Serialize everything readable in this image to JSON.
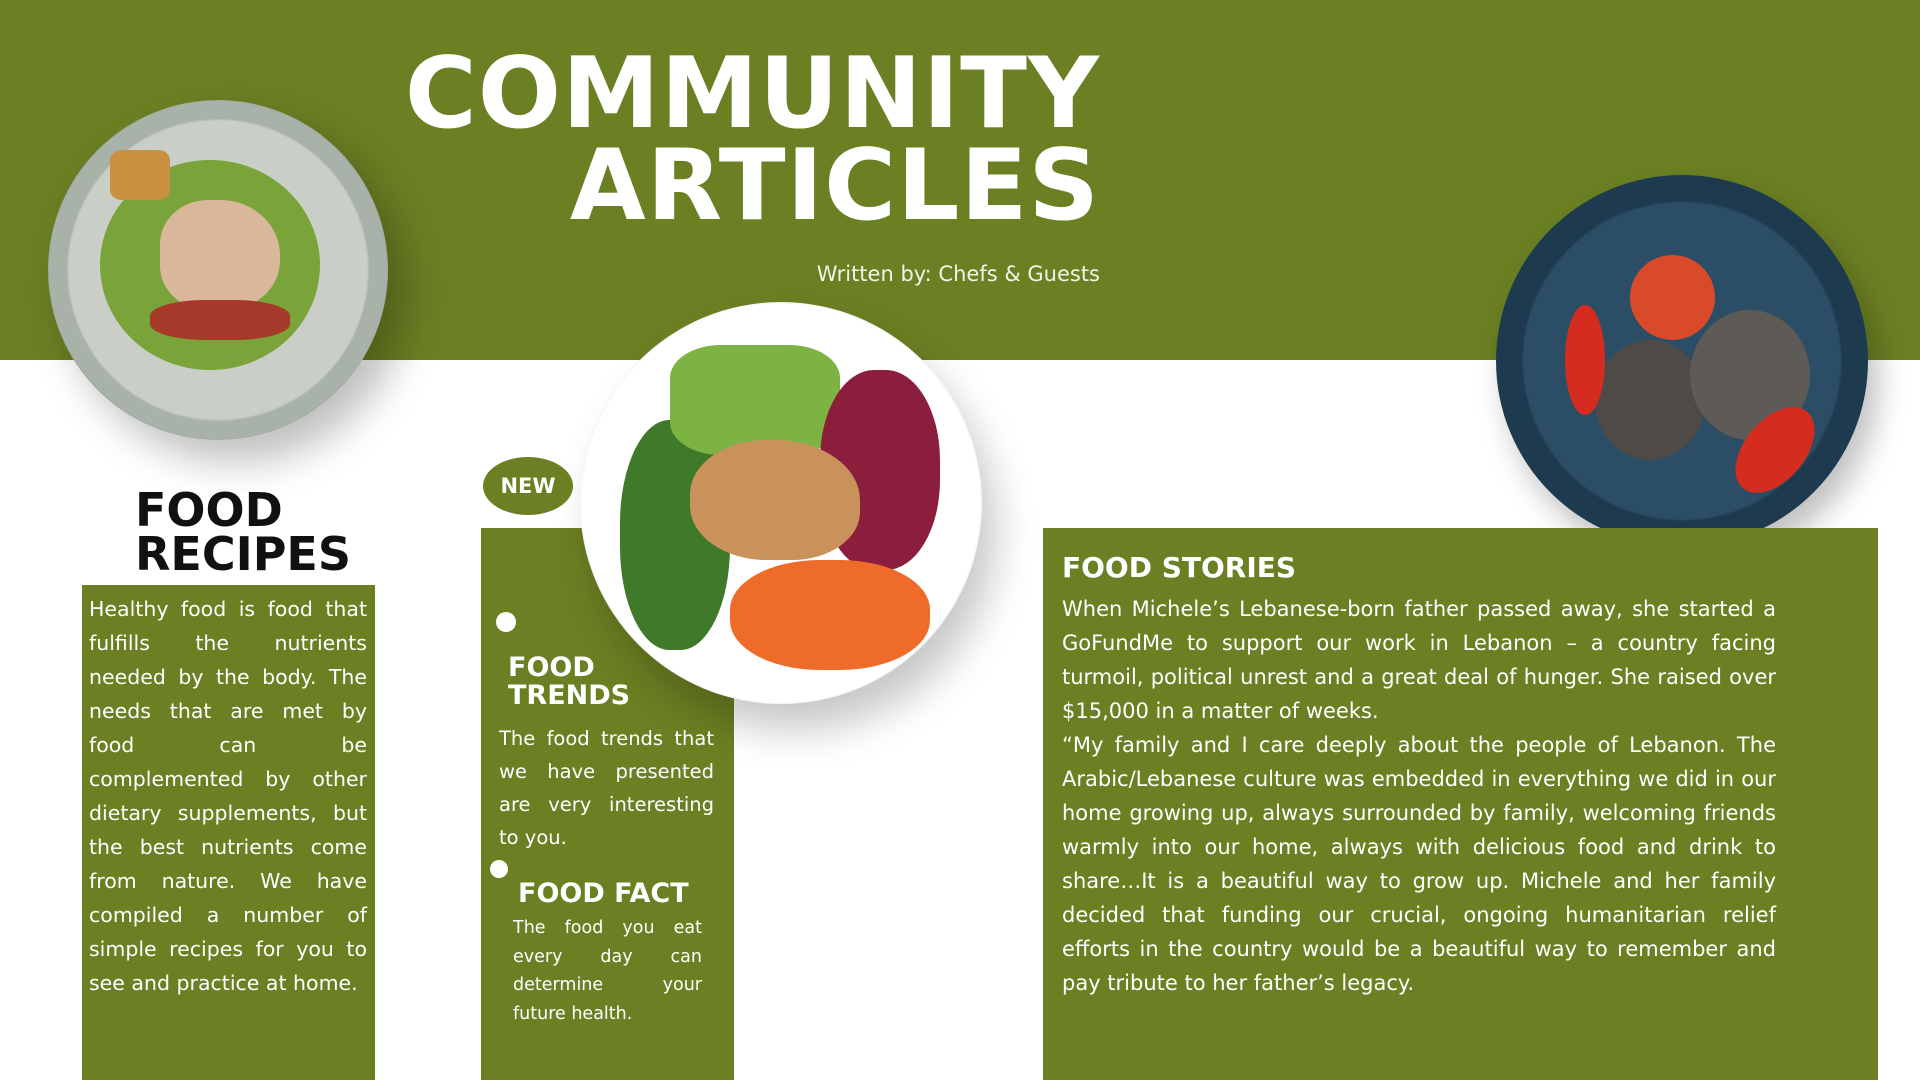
{
  "header": {
    "title_line1": "COMMUNITY",
    "title_line2": "ARTICLES",
    "byline": "Written by: Chefs & Guests"
  },
  "recipes": {
    "heading_line1": "FOOD",
    "heading_line2": "RECIPES",
    "body": "Healthy food is food that fulfills the nutrients needed by the body. The needs that are met by food can be complemented by other dietary supplements, but the best nutrients come from nature. We have compiled a number of simple recipes for you to see and practice at home."
  },
  "trends": {
    "badge": "NEW",
    "heading_line1": "FOOD",
    "heading_line2": "TRENDS",
    "body": "The food trends that we have presented are very interesting to you."
  },
  "fact": {
    "heading": "FOOD FACT",
    "body": "The food you eat every day can determine your future health."
  },
  "stories": {
    "heading": "FOOD STORIES",
    "paragraph1": "When Michele’s Lebanese-born father passed away, she started a GoFundMe to support our work in Lebanon – a country facing turmoil, political unrest and a great deal of hunger. She raised over $15,000 in a matter of weeks.",
    "paragraph2": "“My family and I care deeply about the people of Lebanon. The Arabic/Lebanese culture was embedded in everything we did in our home growing up, always surrounded by family, welcoming friends warmly into our home, always with delicious food and drink to share…It is a beautiful way to grow up. Michele and her family decided that funding our crucial, ongoing humanitarian relief efforts in the country would be a beautiful way to remember and pay tribute to her father’s legacy."
  },
  "colors": {
    "brand_green": "#6b7f23",
    "text_light": "#ffffff",
    "text_dark": "#111111"
  }
}
